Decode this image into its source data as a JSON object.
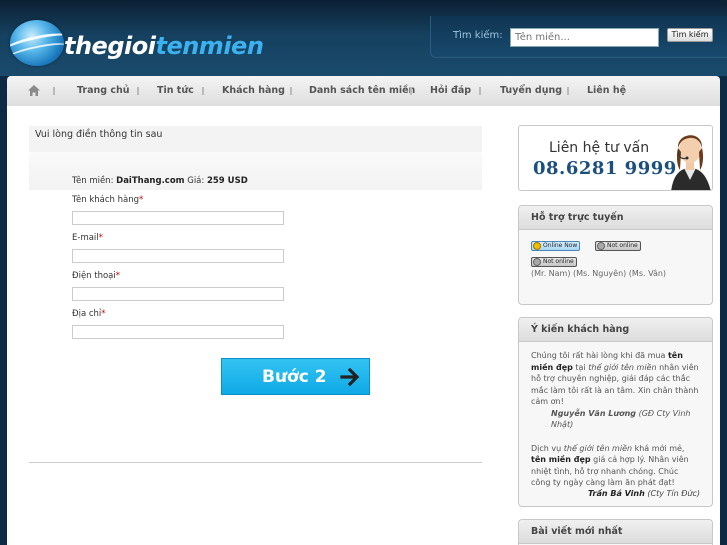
{
  "header": {
    "logo": {
      "part1": "thegioi",
      "part2": "tenmien"
    },
    "search": {
      "label": "Tìm kiếm:",
      "placeholder": "Tên miền...",
      "button": "Tìm kiếm"
    }
  },
  "nav": {
    "items": [
      "Trang chủ",
      "Tin tức",
      "Khách hàng",
      "Danh sách tên miền",
      "Hỏi đáp",
      "Tuyển dụng",
      "Liên hệ"
    ]
  },
  "form": {
    "title": "Vui lòng điền thông tin sau",
    "domain_label": "Tên miền:",
    "domain_value": "DaiThang.com",
    "price_label": "Giá:",
    "price_value": "259 USD",
    "fields": [
      {
        "label": "Tên khách hàng",
        "req": "*"
      },
      {
        "label": "E-mail",
        "req": "*"
      },
      {
        "label": "Điện thoại",
        "req": "*"
      },
      {
        "label": "Địa chỉ",
        "req": "*"
      }
    ],
    "submit": "Bước 2"
  },
  "sidebar": {
    "contact": {
      "title": "Liên hệ tư vấn",
      "phone": "08.6281 9999"
    },
    "support": {
      "title": "Hỗ trợ trực tuyến",
      "badges": [
        "Online Now",
        "Not online",
        "Not online"
      ],
      "names": "(Mr. Nam)        (Ms. Nguyên)          (Ms. Vân)"
    },
    "reviews": {
      "title": "Ý kiến khách hàng",
      "r1": {
        "t1": "Chúng tôi rất hài lòng khi đã mua ",
        "b1": "tên miền đẹp",
        "t2": " tại ",
        "i1": "thế giới tên miền",
        "t3": " nhân viên hỗ trợ chuyên nghiệp, giải đáp các thắc mắc làm tôi rất là an tâm. Xin chân thành cảm ơn!",
        "name": "Nguyễn Văn Lương",
        "org": " (GĐ Cty Vinh Nhật)"
      },
      "r2": {
        "t1": "Dịch vụ ",
        "i1": "thế giới tên miền",
        "t2": " khá mới mẻ, ",
        "b1": "tên miền đẹp",
        "t3": " giá cả hợp lý. Nhân viên nhiệt tình, hỗ trợ nhanh chóng. Chúc công ty ngày càng làm ăn phát đạt!",
        "name": "Trần Bá Vinh",
        "org": " (Cty Tín Đức)"
      }
    },
    "news": {
      "title": "Bài viết mới nhất"
    }
  }
}
